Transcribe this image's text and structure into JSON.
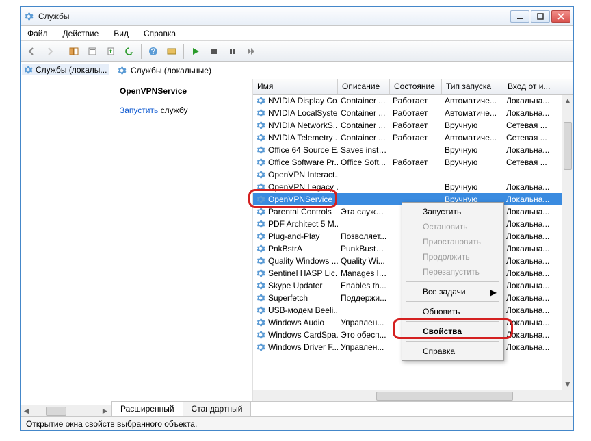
{
  "window": {
    "title": "Службы"
  },
  "menu": {
    "file": "Файл",
    "action": "Действие",
    "view": "Вид",
    "help": "Справка"
  },
  "tree": {
    "item": "Службы (локалы..."
  },
  "main_header": "Службы (локальные)",
  "leftpane": {
    "selected": "OpenVPNService",
    "start_link": "Запустить",
    "start_rest": " службу"
  },
  "columns": {
    "name": "Имя",
    "desc": "Описание",
    "state": "Состояние",
    "start": "Тип запуска",
    "logon": "Вход от и..."
  },
  "services": [
    {
      "name": "NVIDIA Display Co...",
      "desc": "Container ...",
      "state": "Работает",
      "start": "Автоматиче...",
      "logon": "Локальна..."
    },
    {
      "name": "NVIDIA LocalSyste...",
      "desc": "Container ...",
      "state": "Работает",
      "start": "Автоматиче...",
      "logon": "Локальна..."
    },
    {
      "name": "NVIDIA NetworkS...",
      "desc": "Container ...",
      "state": "Работает",
      "start": "Вручную",
      "logon": "Сетевая ..."
    },
    {
      "name": "NVIDIA Telemetry ...",
      "desc": "Container ...",
      "state": "Работает",
      "start": "Автоматиче...",
      "logon": "Сетевая ..."
    },
    {
      "name": "Office 64 Source E...",
      "desc": "Saves insta...",
      "state": "",
      "start": "Вручную",
      "logon": "Локальна..."
    },
    {
      "name": "Office Software Pr...",
      "desc": "Office Soft...",
      "state": "Работает",
      "start": "Вручную",
      "logon": "Сетевая ..."
    },
    {
      "name": "OpenVPN Interact...",
      "desc": "",
      "state": "",
      "start": "",
      "logon": ""
    },
    {
      "name": "OpenVPN Legacy ...",
      "desc": "",
      "state": "",
      "start": "Вручную",
      "logon": "Локальна..."
    },
    {
      "name": "OpenVPNService",
      "desc": "",
      "state": "",
      "start": "Вручную",
      "logon": "Локальна...",
      "selected": true
    },
    {
      "name": "Parental Controls",
      "desc": "Эта служб...",
      "state": "",
      "start": "",
      "logon": "Локальна..."
    },
    {
      "name": "PDF Architect 5 M...",
      "desc": "",
      "state": "",
      "start": "",
      "logon": "Локальна..."
    },
    {
      "name": "Plug-and-Play",
      "desc": "Позволяет...",
      "state": "",
      "start": "",
      "logon": "Локальна..."
    },
    {
      "name": "PnkBstrA",
      "desc": "PunkBuster...",
      "state": "",
      "start": "",
      "logon": "Локальна..."
    },
    {
      "name": "Quality Windows ...",
      "desc": "Quality Wi...",
      "state": "",
      "start": "",
      "logon": "Локальна..."
    },
    {
      "name": "Sentinel HASP Lic...",
      "desc": "Manages li...",
      "state": "",
      "start": "",
      "logon": "Локальна..."
    },
    {
      "name": "Skype Updater",
      "desc": "Enables th...",
      "state": "",
      "start": "",
      "logon": "Локальна..."
    },
    {
      "name": "Superfetch",
      "desc": "Поддержи...",
      "state": "",
      "start": "",
      "logon": "Локальна..."
    },
    {
      "name": "USB-модем Beeli...",
      "desc": "",
      "state": "",
      "start": "",
      "logon": "Локальна..."
    },
    {
      "name": "Windows Audio",
      "desc": "Управлен...",
      "state": "",
      "start": "",
      "logon": "Локальна..."
    },
    {
      "name": "Windows CardSpa...",
      "desc": "Это обесп...",
      "state": "",
      "start": "",
      "logon": "Локальна..."
    },
    {
      "name": "Windows Driver F...",
      "desc": "Управлен...",
      "state": "",
      "start": "",
      "logon": "Локальна..."
    }
  ],
  "tabs": {
    "extended": "Расширенный",
    "standard": "Стандартный"
  },
  "status": "Открытие окна свойств выбранного объекта.",
  "ctx": {
    "start": "Запустить",
    "stop": "Остановить",
    "pause": "Приостановить",
    "resume": "Продолжить",
    "restart": "Перезапустить",
    "alltasks": "Все задачи",
    "refresh": "Обновить",
    "properties": "Свойства",
    "help": "Справка"
  }
}
